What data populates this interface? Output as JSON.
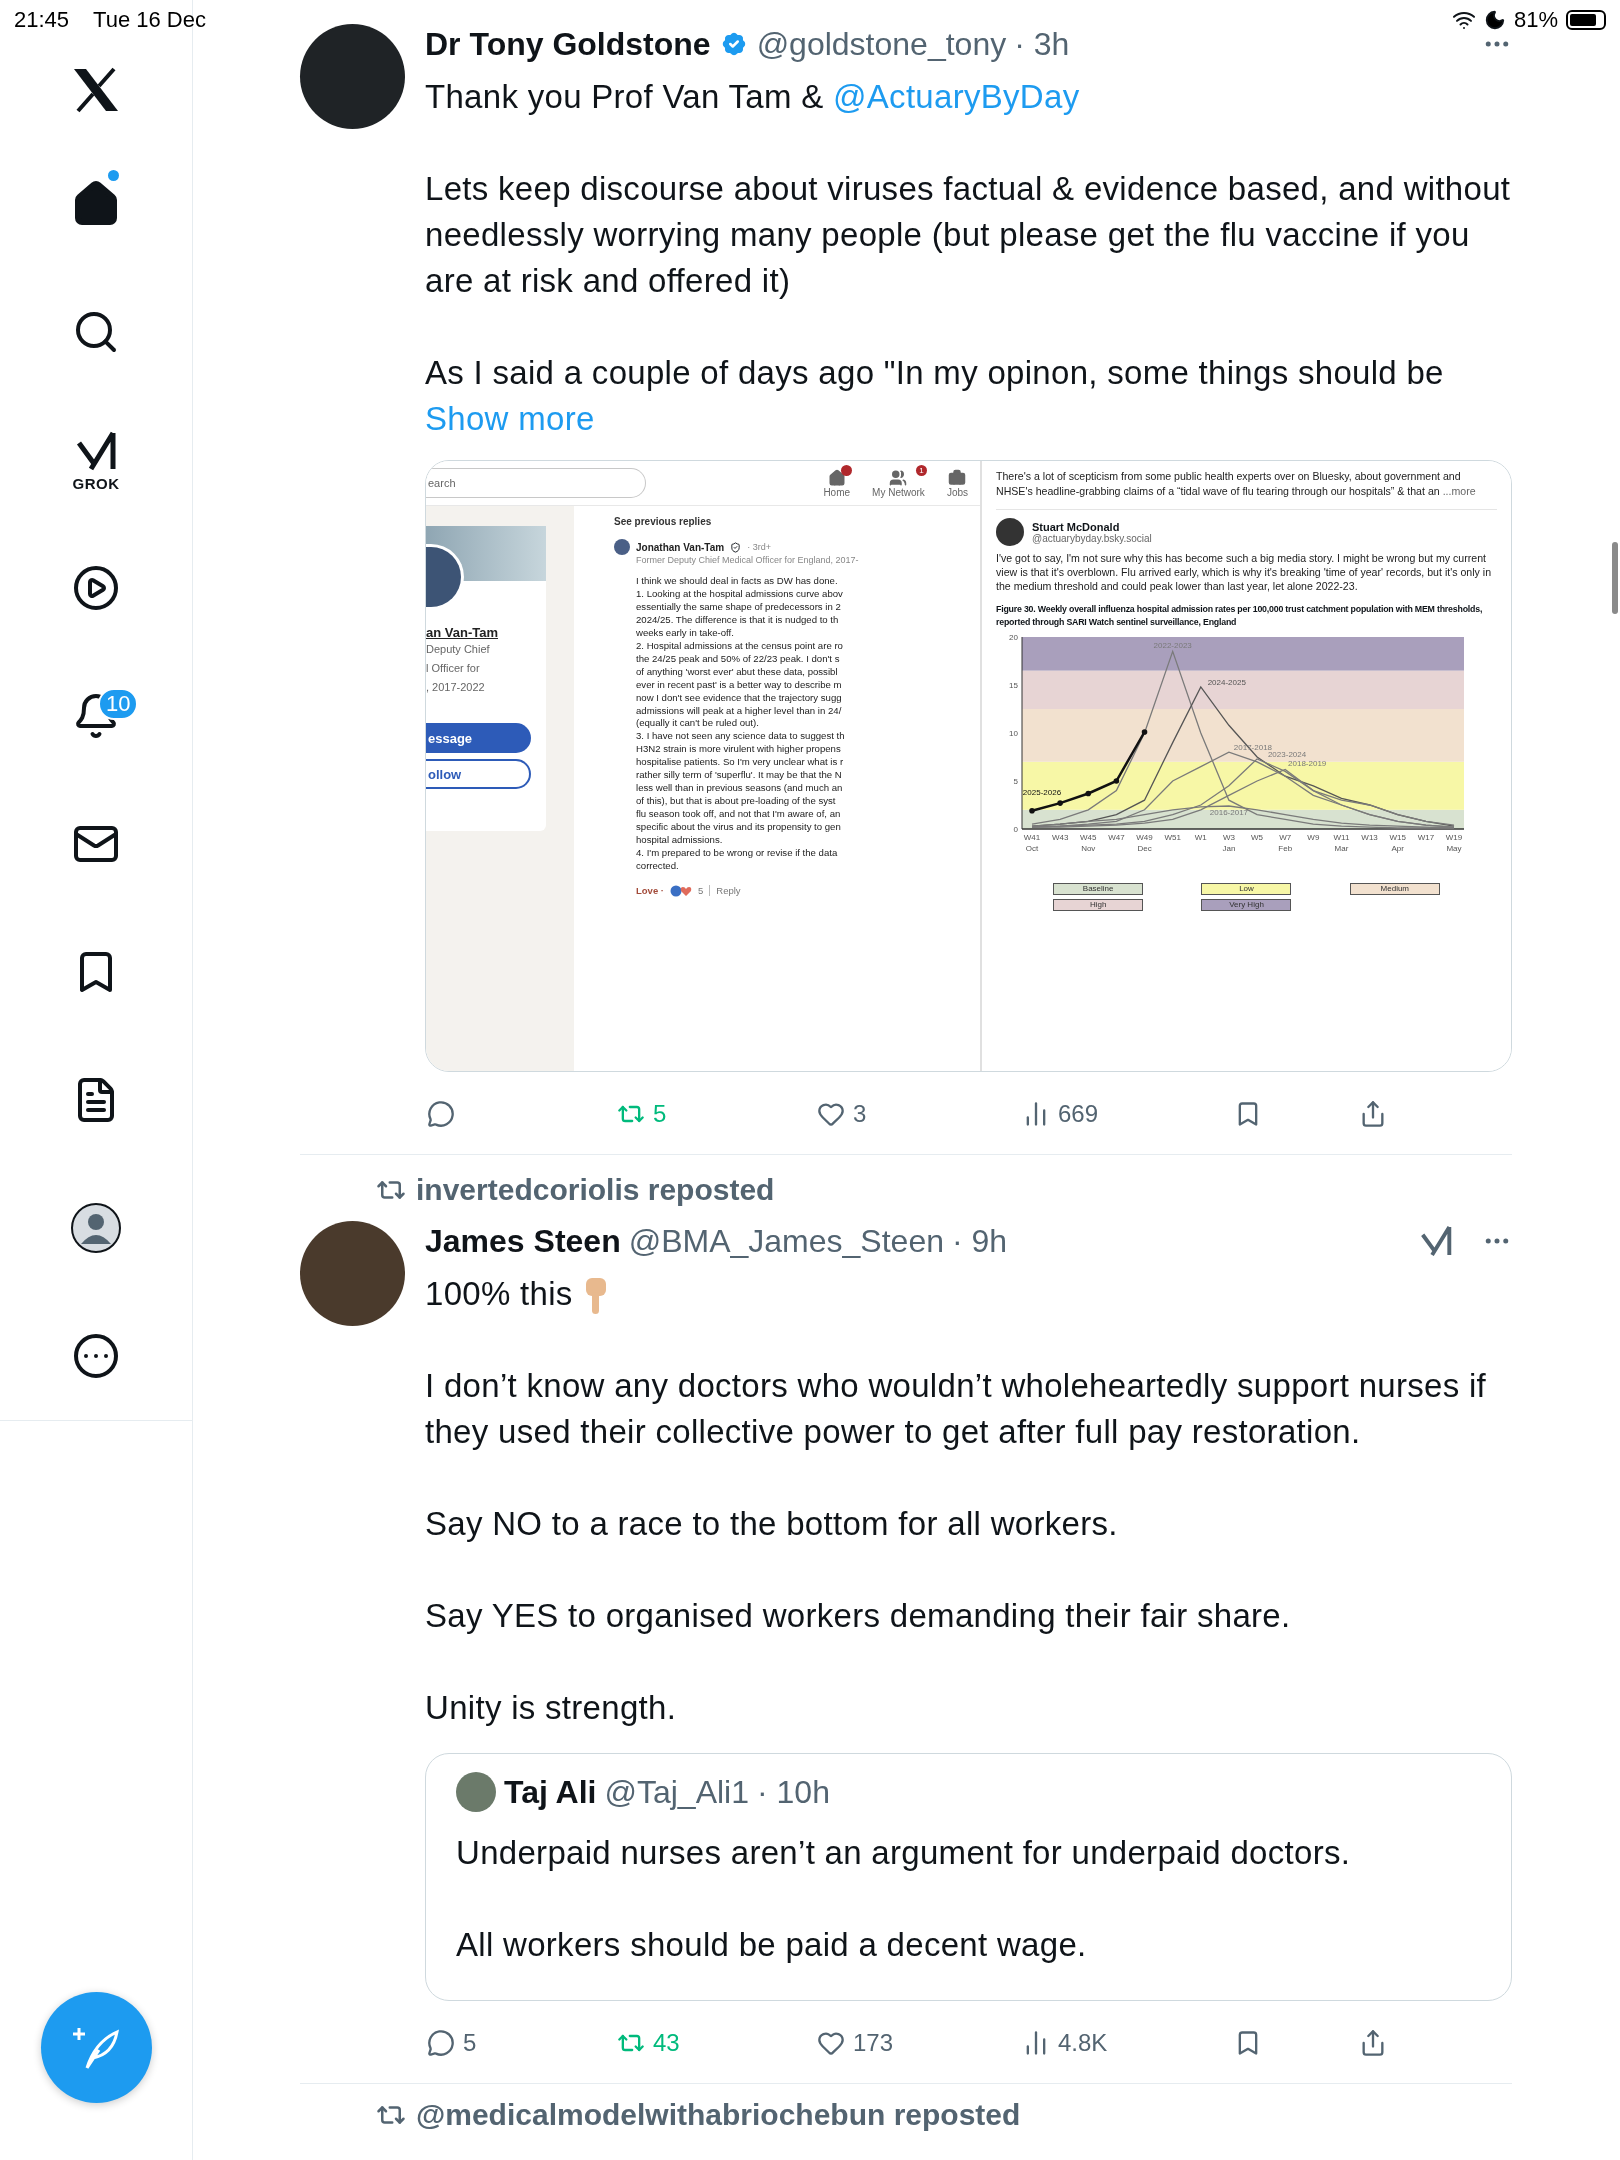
{
  "status_bar": {
    "time": "21:45",
    "date": "Tue 16 Dec",
    "battery": "81%"
  },
  "sidebar": {
    "items": [
      {
        "kind": "home",
        "selected": true,
        "dot": true
      },
      {
        "kind": "search",
        "selected": false
      },
      {
        "kind": "grok",
        "label": "GROK",
        "selected": false
      },
      {
        "kind": "video",
        "selected": false
      },
      {
        "kind": "notifications",
        "badge": "10",
        "selected": false
      },
      {
        "kind": "messages",
        "selected": false
      },
      {
        "kind": "bookmarks",
        "selected": false
      },
      {
        "kind": "lists",
        "selected": false
      },
      {
        "kind": "profile",
        "selected": false
      },
      {
        "kind": "more",
        "selected": false
      }
    ]
  },
  "tweets": [
    {
      "author": "Dr Tony Goldstone",
      "verified": true,
      "handle": "@goldstone_tony",
      "time": "· 3h",
      "grok": false,
      "paragraphs": [
        [
          {
            "kind": "plain",
            "text": "Thank you Prof Van Tam & "
          },
          {
            "kind": "link",
            "text": "@ActuaryByDay"
          }
        ],
        [
          {
            "kind": "plain",
            "text": "Lets keep discourse about viruses factual & evidence based, and without needlessly worrying many people (but please get the flu vaccine if you are at risk and offered it)"
          }
        ],
        [
          {
            "kind": "plain",
            "text": "As I said a couple of days ago \"In my opinon, some things should be "
          },
          {
            "kind": "link",
            "text": "Show more"
          }
        ]
      ],
      "media": {
        "left": {
          "search_placeholder": "earch",
          "nav": [
            {
              "label": "Home",
              "dot": true
            },
            {
              "label": "My Network",
              "badge": "1"
            },
            {
              "label": "Jobs"
            }
          ],
          "profile": {
            "name": "an Van-Tam",
            "lines": [
              "Deputy Chief",
              "l Officer for",
              ", 2017-2022"
            ],
            "buttons": [
              {
                "kind": "primary",
                "label": "essage"
              },
              {
                "kind": "outline",
                "label": "ollow"
              }
            ]
          },
          "comment": {
            "see_previous": "See previous replies",
            "author": "Jonathan Van-Tam",
            "degree": "· 3rd+",
            "headline": "Former Deputy Chief Medical Officer for England, 2017-",
            "body": "I think we should deal in facts as DW has done.\n1. Looking at the hospital admissions curve abov\nessentially the same shape of predecessors in 2\n2024/25. The difference is that it is nudged to th\nweeks early in take-off.\n2. Hospital admissions at the census point are ro\nthe 24/25 peak and 50% of 22/23 peak. I don't s\nof anything 'worst ever' abut these data, possibl\never in recent past' is a better way to describe m\nnow I don't see evidence that the trajectory sugg\nadmissions will peak at a higher level than in 24/\n(equally it can't be ruled out).\n3. I have not seen any science data to suggest th\nH3N2 strain is more virulent with higher propens\nhospitalise patients. So I'm very unclear what is r\nrather silly term of 'superflu'. It may be that the N\nless well than in previous seasons (and much an\nof this), but that is about pre-loading of the syst\nflu season took off, and not that I'm aware of, an\nspecific about the virus and its propensity to gen\nhospital admissions.\n4. I'm prepared to be wrong or revise if the data\ncorrected.",
            "reaction": "Love ·",
            "reaction_count": "5",
            "reply": "Reply"
          }
        },
        "right": {
          "intro": "There's a lot of scepticism from some public health experts over on Bluesky, about government and NHSE's headline-grabbing claims of a “tidal wave of flu tearing through our hospitals” & that an",
          "more": "...more",
          "author": "Stuart McDonald",
          "handle": "@actuarybyday.bsky.social",
          "body": "I've got to say, I'm not sure why this has become such a big media story. I might be wrong but my current view is that it's overblown. Flu arrived early, which is why it's breaking 'time of year' records, but it's only in the medium threshold and could peak lower than last year, let alone 2022-23.",
          "chart_data": {
            "type": "line",
            "title": "Figure 30. Weekly overall influenza hospital admission rates per 100,000 trust catchment population with MEM thresholds, reported through SARI Watch sentinel surveillance, England",
            "categories": [
              "W41",
              "W43",
              "W45",
              "W47",
              "W49",
              "W51",
              "W1",
              "W3",
              "W5",
              "W7",
              "W9",
              "W11",
              "W13",
              "W15",
              "W17",
              "W19"
            ],
            "ylim": [
              0,
              20
            ],
            "yticks": [
              0,
              5,
              10,
              15,
              20
            ],
            "series": [
              {
                "name": "2022-2023",
                "color": "#7a7a7a",
                "values": [
                  0.5,
                  1,
                  2,
                  4,
                  10,
                  18.5,
                  10,
                  3,
                  1.5,
                  1,
                  0.5,
                  0.3,
                  0.2,
                  0.1,
                  0.1,
                  0.1
                ]
              },
              {
                "name": "2024-2025",
                "color": "#555555",
                "values": [
                  0.3,
                  0.5,
                  0.8,
                  1.5,
                  3,
                  9,
                  14.8,
                  10.8,
                  7.5,
                  5.5,
                  4.5,
                  3.2,
                  2.5,
                  1.5,
                  0.8,
                  0.3
                ]
              },
              {
                "name": "2017-2018",
                "color": "#7a7a7a",
                "values": [
                  0.2,
                  0.3,
                  0.5,
                  0.8,
                  2,
                  5,
                  6.5,
                  8,
                  7,
                  5.5,
                  3.5,
                  2.5,
                  1.5,
                  0.8,
                  0.4,
                  0.2
                ]
              },
              {
                "name": "2023-2024",
                "color": "#7a7a7a",
                "values": [
                  0.2,
                  0.3,
                  0.4,
                  0.5,
                  0.8,
                  1.5,
                  2.5,
                  4.5,
                  7.3,
                  6,
                  4,
                  3,
                  2.5,
                  1.5,
                  0.8,
                  0.4
                ]
              },
              {
                "name": "2018-2019",
                "color": "#7a7a7a",
                "values": [
                  0.2,
                  0.2,
                  0.3,
                  0.4,
                  0.6,
                  1,
                  2,
                  3.5,
                  5,
                  6.2,
                  4,
                  2.5,
                  1.5,
                  0.8,
                  0.4,
                  0.2
                ]
              },
              {
                "name": "2016-2017",
                "color": "#7a7a7a",
                "values": [
                  0.3,
                  0.5,
                  0.8,
                  1,
                  1.5,
                  2,
                  2.3,
                  2.4,
                  2,
                  1.5,
                  1,
                  0.6,
                  0.4,
                  0.3,
                  0.2,
                  0.1
                ]
              },
              {
                "name": "2025-2026",
                "color": "#111111",
                "values": [
                  1.9,
                  2.7,
                  3.7,
                  5,
                  10.1,
                  null,
                  null,
                  null,
                  null,
                  null,
                  null,
                  null,
                  null,
                  null,
                  null,
                  null
                ]
              }
            ],
            "bands": [
              {
                "axis": "y",
                "from": 0,
                "to": 2,
                "label": "Baseline",
                "color": "#d8e2d0"
              },
              {
                "axis": "y",
                "from": 2,
                "to": 7,
                "label": "Low",
                "color": "#f7f7a6"
              },
              {
                "axis": "y",
                "from": 7,
                "to": 12.5,
                "label": "Medium",
                "color": "#f2e1cf"
              },
              {
                "axis": "y",
                "from": 12.5,
                "to": 16.5,
                "label": "High",
                "color": "#e7d4d4"
              },
              {
                "axis": "y",
                "from": 16.5,
                "to": 20,
                "label": "Very High",
                "color": "#a99fbc"
              }
            ]
          },
          "month_labels": [
            "Oct",
            "Nov",
            "Dec",
            "Jan",
            "Feb",
            "Mar",
            "Apr",
            "May"
          ]
        }
      },
      "actions": [
        {
          "kind": "reply",
          "active": false
        },
        {
          "kind": "repost",
          "count": "5",
          "active": true
        },
        {
          "kind": "like",
          "count": "3",
          "active": false
        },
        {
          "kind": "views",
          "count": "669",
          "active": false
        },
        {
          "kind": "bookmark",
          "active": false
        },
        {
          "kind": "share",
          "active": false
        }
      ]
    },
    {
      "reposted_by": "invertedcoriolis reposted",
      "author": "James Steen",
      "verified": false,
      "handle": "@BMA_James_Steen",
      "time": "· 9h",
      "grok": true,
      "paragraphs": [
        [
          {
            "kind": "plain",
            "text": "100% this "
          },
          {
            "kind": "emoji"
          }
        ],
        [
          {
            "kind": "plain",
            "text": "I don’t know any doctors who wouldn’t wholeheartedly support nurses if they used their collective power to get after full pay restoration."
          }
        ],
        [
          {
            "kind": "plain",
            "text": "Say NO to a race to the bottom for all workers."
          }
        ],
        [
          {
            "kind": "plain",
            "text": "Say YES to organised workers demanding their fair share."
          }
        ],
        [
          {
            "kind": "plain",
            "text": "Unity is strength."
          }
        ]
      ],
      "quote": {
        "author": "Taj Ali",
        "handle": "@Taj_Ali1",
        "time": "· 10h",
        "paragraphs": [
          "Underpaid nurses aren’t an argument for underpaid doctors.",
          "All workers should be paid a decent wage."
        ]
      },
      "actions": [
        {
          "kind": "reply",
          "count": "5",
          "active": false
        },
        {
          "kind": "repost",
          "count": "43",
          "active": true
        },
        {
          "kind": "like",
          "count": "173",
          "active": false
        },
        {
          "kind": "views",
          "count": "4.8K",
          "active": false
        },
        {
          "kind": "bookmark",
          "active": false
        },
        {
          "kind": "share",
          "active": false
        }
      ]
    }
  ],
  "next_repost": "@medicalmodelwithabriochebun reposted"
}
